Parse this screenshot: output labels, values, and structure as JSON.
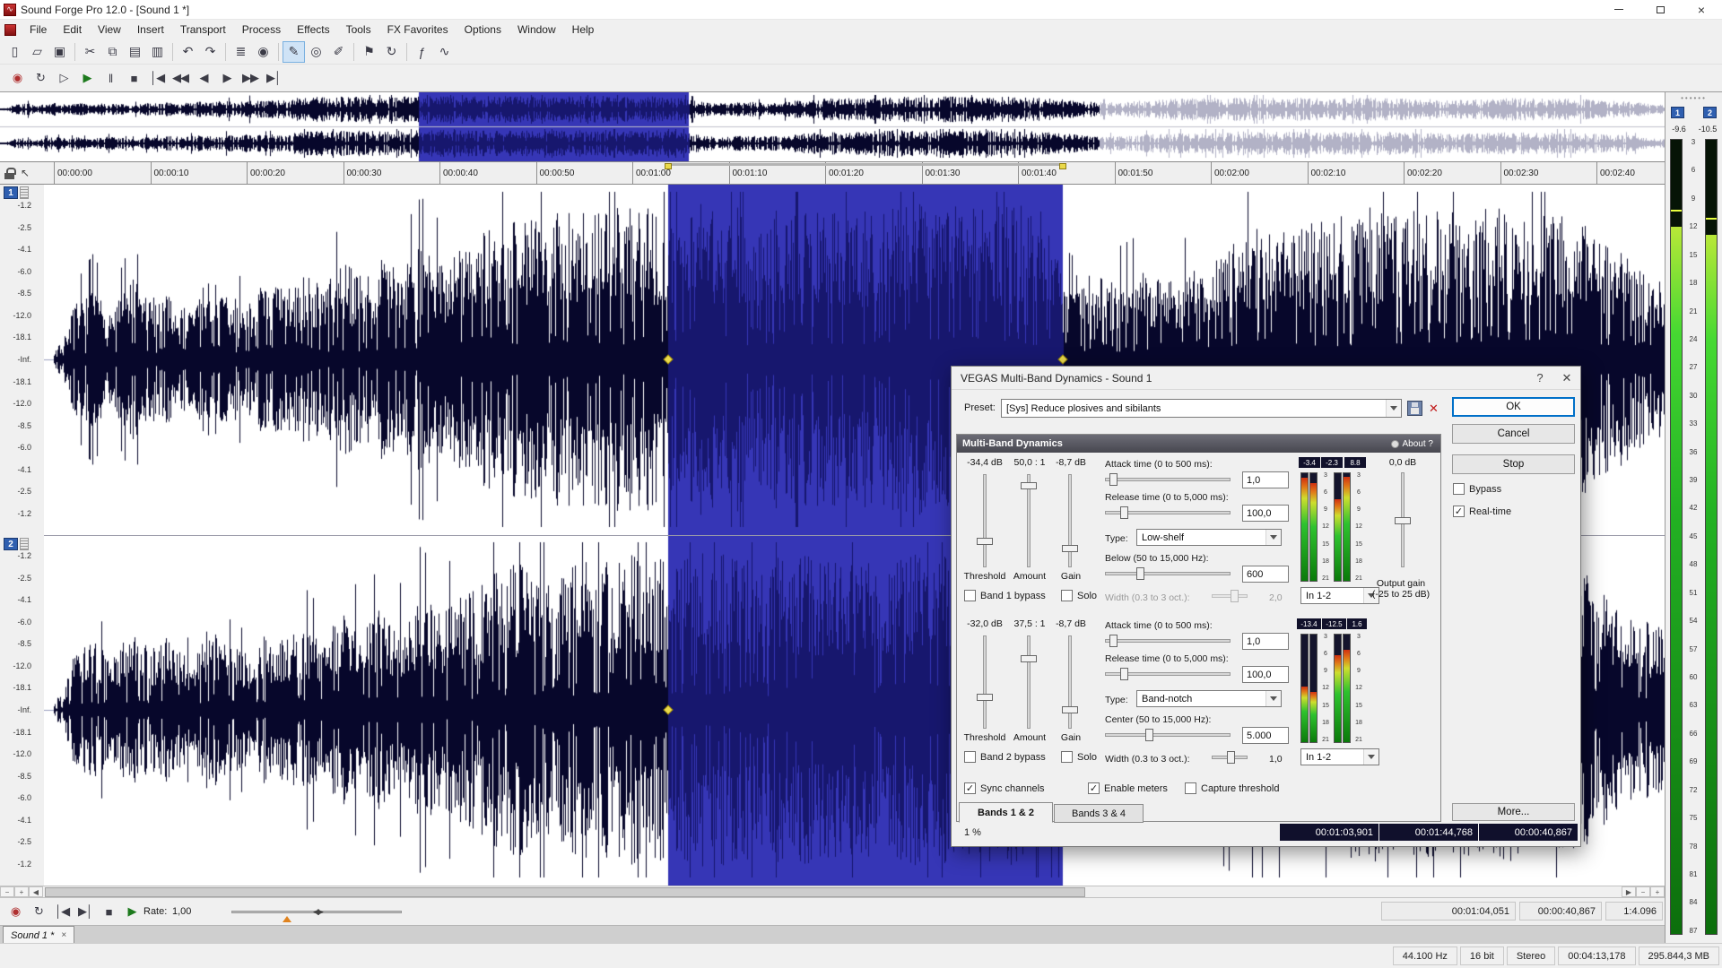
{
  "window": {
    "title": "Sound Forge Pro 12.0 - [Sound 1 *]"
  },
  "menu": [
    "File",
    "Edit",
    "View",
    "Insert",
    "Transport",
    "Process",
    "Effects",
    "Tools",
    "FX Favorites",
    "Options",
    "Window",
    "Help"
  ],
  "toolbar": {
    "icons": [
      {
        "name": "new-file",
        "glyph": "▯"
      },
      {
        "name": "open-file",
        "glyph": "▱"
      },
      {
        "name": "save",
        "glyph": "▣"
      },
      {
        "name": "cut",
        "glyph": "✂"
      },
      {
        "name": "copy",
        "glyph": "⧉"
      },
      {
        "name": "paste",
        "glyph": "▤"
      },
      {
        "name": "trim",
        "glyph": "▥"
      },
      {
        "name": "undo",
        "glyph": "↶"
      },
      {
        "name": "redo",
        "glyph": "↷"
      },
      {
        "name": "mixer",
        "glyph": "≣"
      },
      {
        "name": "record",
        "glyph": "◉"
      },
      {
        "name": "edit-tool",
        "glyph": "✎"
      },
      {
        "name": "zoom-tool",
        "glyph": "◎"
      },
      {
        "name": "pencil-tool",
        "glyph": "✐"
      },
      {
        "name": "marker",
        "glyph": "⚑"
      },
      {
        "name": "loop-region",
        "glyph": "↻"
      },
      {
        "name": "fx-chain",
        "glyph": "ƒ"
      },
      {
        "name": "spectrum",
        "glyph": "∿"
      }
    ]
  },
  "transport": {
    "icons": [
      {
        "name": "record",
        "glyph": "◉"
      },
      {
        "name": "loop-playback",
        "glyph": "↻"
      },
      {
        "name": "play-all",
        "glyph": "▷"
      },
      {
        "name": "play",
        "glyph": "▶"
      },
      {
        "name": "pause",
        "glyph": "‖"
      },
      {
        "name": "stop",
        "glyph": "■"
      },
      {
        "name": "go-to-start",
        "glyph": "│◀"
      },
      {
        "name": "rewind",
        "glyph": "◀◀"
      },
      {
        "name": "step-back",
        "glyph": "◀"
      },
      {
        "name": "step-forward",
        "glyph": "▶"
      },
      {
        "name": "fast-forward",
        "glyph": "▶▶"
      },
      {
        "name": "go-to-end",
        "glyph": "▶│"
      }
    ]
  },
  "timeline": {
    "ticks": [
      "00:00:00",
      "00:00:10",
      "00:00:20",
      "00:00:30",
      "00:00:40",
      "00:00:50",
      "00:01:00",
      "00:01:10",
      "00:01:20",
      "00:01:30",
      "00:01:40",
      "00:01:50",
      "00:02:00",
      "00:02:10",
      "00:02:20",
      "00:02:30",
      "00:02:40"
    ]
  },
  "waveform": {
    "db_labels": [
      "-1.2",
      "-2.5",
      "-4.1",
      "-6.0",
      "-8.5",
      "-12.0",
      "-18.1",
      "-Inf.",
      "-18.1",
      "-12.0",
      "-8.5",
      "-6.0",
      "-4.1",
      "-2.5",
      "-1.2"
    ]
  },
  "channels": [
    "1",
    "2"
  ],
  "dialog": {
    "title": "VEGAS Multi-Band Dynamics - Sound 1",
    "help_icon": "?",
    "close_icon": "✕",
    "preset": {
      "label": "Preset:",
      "value": "[Sys] Reduce plosives and sibilants"
    },
    "buttons": {
      "ok": "OK",
      "cancel": "Cancel",
      "stop": "Stop",
      "more": "More..."
    },
    "options": {
      "bypass": "Bypass",
      "realtime": "Real-time"
    },
    "panel": {
      "title": "Multi-Band Dynamics",
      "about": "About ?"
    },
    "meter_scale": [
      "3",
      "6",
      "9",
      "12",
      "15",
      "18",
      "21"
    ],
    "bands": [
      {
        "threshold": "-34,4 dB",
        "amount": "50,0 : 1",
        "gain": "-8,7 dB",
        "threshold_label": "Threshold",
        "amount_label": "Amount",
        "gain_label": "Gain",
        "bypass": "Band 1 bypass",
        "solo": "Solo",
        "attack_label": "Attack time (0 to 500 ms):",
        "attack": "1,0",
        "release_label": "Release time (0 to 5,000 ms):",
        "release": "100,0",
        "type_label": "Type:",
        "type": "Low-shelf",
        "freq_label": "Below (50 to 15,000 Hz):",
        "freq": "600",
        "width_label": "Width (0.3 to 3 oct.):",
        "width": "2,0",
        "routing": "In 1-2",
        "meters": [
          "-3.4",
          "-2.3",
          "8.8"
        ]
      },
      {
        "threshold": "-32,0 dB",
        "amount": "37,5 : 1",
        "gain": "-8,7 dB",
        "threshold_label": "Threshold",
        "amount_label": "Amount",
        "gain_label": "Gain",
        "bypass": "Band 2 bypass",
        "solo": "Solo",
        "attack_label": "Attack time (0 to 500 ms):",
        "attack": "1,0",
        "release_label": "Release time (0 to 5,000 ms):",
        "release": "100,0",
        "type_label": "Type:",
        "type": "Band-notch",
        "freq_label": "Center (50 to 15,000 Hz):",
        "freq": "5.000",
        "width_label": "Width (0.3 to 3 oct.):",
        "width": "1,0",
        "routing": "In 1-2",
        "meters": [
          "-13.4",
          "-12.5",
          "1.6"
        ]
      }
    ],
    "output": {
      "value": "0,0 dB",
      "label1": "Output gain",
      "label2": "(-25 to 25 dB)"
    },
    "footer_checks": {
      "sync": "Sync channels",
      "enable": "Enable meters",
      "capture": "Capture threshold"
    },
    "tabs": [
      "Bands 1 & 2",
      "Bands 3 & 4"
    ],
    "progress": "1 %",
    "selection": {
      "start": "00:01:03,901",
      "end": "00:01:44,768",
      "length": "00:00:40,867"
    }
  },
  "meters_panel": {
    "channel_labels": [
      "1",
      "2"
    ],
    "peaks": [
      "-9.6",
      "-10.5"
    ],
    "scale": [
      "3",
      "6",
      "9",
      "12",
      "15",
      "18",
      "21",
      "24",
      "27",
      "30",
      "33",
      "36",
      "39",
      "42",
      "45",
      "48",
      "51",
      "54",
      "57",
      "60",
      "63",
      "66",
      "69",
      "72",
      "75",
      "78",
      "81",
      "84",
      "87"
    ]
  },
  "bottom": {
    "icons": [
      {
        "name": "record",
        "glyph": "◉"
      },
      {
        "name": "loop",
        "glyph": "↻"
      },
      {
        "name": "go-to-start",
        "glyph": "│◀"
      },
      {
        "name": "go-to-end",
        "glyph": "▶│"
      },
      {
        "name": "stop",
        "glyph": "■"
      },
      {
        "name": "play",
        "glyph": "▶"
      }
    ],
    "rate_label": "Rate:",
    "rate_value": "1,00",
    "position": "00:01:04,051",
    "selection_length": "00:00:40,867",
    "zoom_ratio": "1:4.096"
  },
  "doc_tab": {
    "label": "Sound 1 *",
    "close": "×"
  },
  "status": {
    "sample_rate": "44.100 Hz",
    "bit_depth": "16 bit",
    "mode": "Stereo",
    "length": "00:04:13,178",
    "size": "295.844,3 MB"
  },
  "colors": {
    "selection": "#3636b6",
    "selection_wave": "#17176e",
    "waveform": "#07072b",
    "dim_wave": "#b2b2c6",
    "accent": "#0078d7"
  }
}
